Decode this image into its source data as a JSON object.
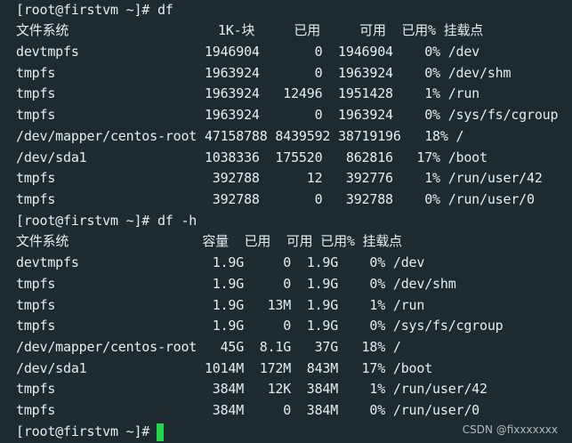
{
  "terminal": {
    "lines": [
      "[root@firstvm ~]# df",
      "文件系统                   1K-块     已用     可用  已用% 挂载点",
      "devtmpfs                1946904       0  1946904    0% /dev",
      "tmpfs                   1963924       0  1963924    0% /dev/shm",
      "tmpfs                   1963924   12496  1951428    1% /run",
      "tmpfs                   1963924       0  1963924    0% /sys/fs/cgroup",
      "/dev/mapper/centos-root 47158788 8439592 38719196   18% /",
      "/dev/sda1               1038336  175520   862816   17% /boot",
      "tmpfs                    392788      12   392776    1% /run/user/42",
      "tmpfs                    392788       0   392788    0% /run/user/0",
      "[root@firstvm ~]# df -h",
      "文件系统                 容量  已用  可用 已用% 挂载点",
      "devtmpfs                 1.9G     0  1.9G    0% /dev",
      "tmpfs                    1.9G     0  1.9G    0% /dev/shm",
      "tmpfs                    1.9G   13M  1.9G    1% /run",
      "tmpfs                    1.9G     0  1.9G    0% /sys/fs/cgroup",
      "/dev/mapper/centos-root   45G  8.1G   37G   18% /",
      "/dev/sda1               1014M  172M  843M   17% /boot",
      "tmpfs                    384M   12K  384M    1% /run/user/42",
      "tmpfs                    384M     0  384M    0% /run/user/0",
      "[root@firstvm ~]# "
    ]
  },
  "watermark": "CSDN @fixxxxxxx",
  "colors": {
    "background": "#1d2b31",
    "text": "#e6ecee",
    "cursor": "#23d84a"
  }
}
